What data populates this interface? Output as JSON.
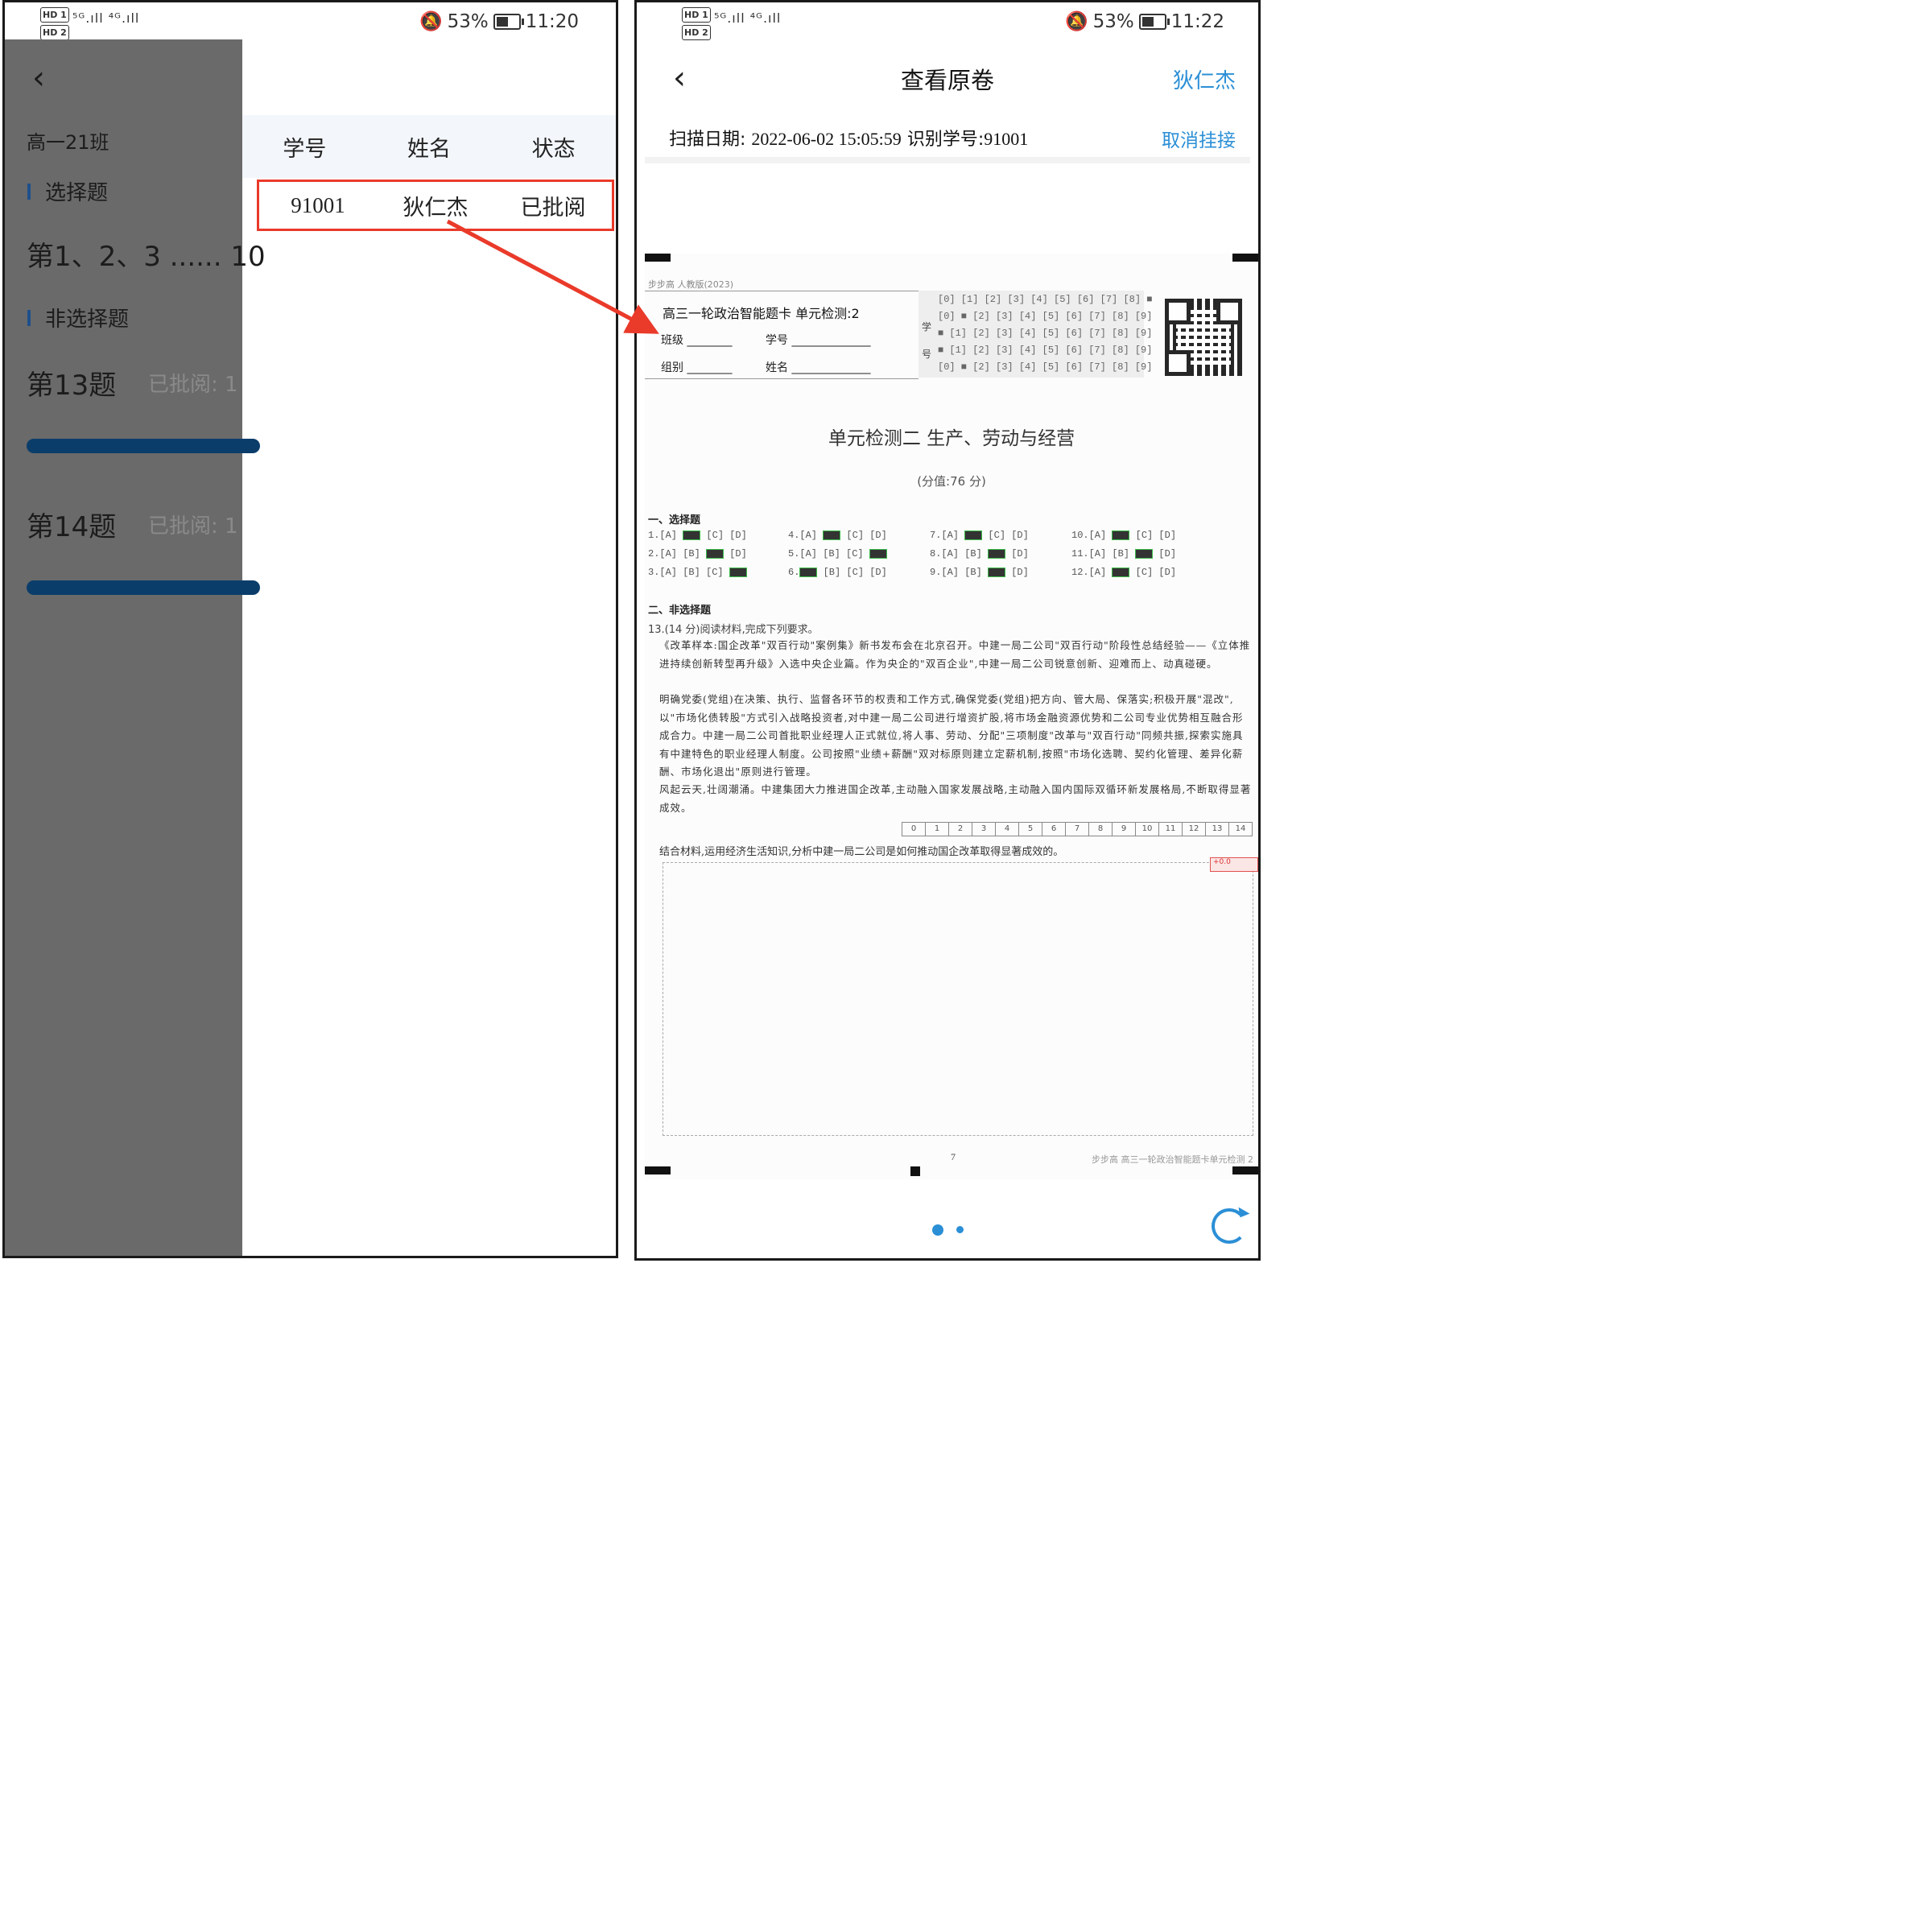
{
  "left_phone": {
    "status": {
      "hd1": "HD 1",
      "hd2": "HD 2",
      "signal": "⁵ᴳ.ıll ⁴ᴳ.ıll",
      "battery": "53%",
      "time": "11:20"
    },
    "drawer": {
      "class_name": "高一21班",
      "section_choice": "选择题",
      "choice_questions": "第1、2、3 ...... 10",
      "section_nonchoice": "非选择题",
      "q13_title": "第13题",
      "q13_status": "已批阅: 1",
      "q14_title": "第14题",
      "q14_status": "已批阅: 1"
    },
    "table": {
      "headers": [
        "学号",
        "姓名",
        "状态"
      ],
      "row": {
        "id": "91001",
        "name": "狄仁杰",
        "status": "已批阅"
      }
    }
  },
  "right_phone": {
    "status": {
      "hd1": "HD 1",
      "hd2": "HD 2",
      "signal": "⁵ᴳ.ıll ⁴ᴳ.ıll",
      "battery": "53%",
      "time": "11:22"
    },
    "nav": {
      "title": "查看原卷",
      "student": "狄仁杰"
    },
    "scan": {
      "label": "扫描日期:",
      "date": "2022-06-02 15:05:59",
      "id_label": "识别学号:",
      "id": "91001",
      "unlink": "取消挂接"
    },
    "paper": {
      "publisher": "步步高  人教版(2023)",
      "card_title": "高三一轮政治智能题卡  单元检测:2",
      "class_label": "班级",
      "group_label": "组别",
      "id_label": "学号",
      "name_label": "姓名",
      "id_side": "学号",
      "id_rows": [
        "[0] [1] [2] [3] [4] [5] [6] [7] [8] ■",
        "[0] ■ [2] [3] [4] [5] [6] [7] [8] [9]",
        "■ [1] [2] [3] [4] [5] [6] [7] [8] [9]",
        "■ [1] [2] [3] [4] [5] [6] [7] [8] [9]",
        "[0] ■ [2] [3] [4] [5] [6] [7] [8] [9]"
      ],
      "unit_title": "单元检测二  生产、劳动与经营",
      "unit_sub": "(分值:76 分)",
      "sec1": "一、选择题",
      "mc_rows": [
        [
          "1.[A]",
          "[C]  [D]",
          "4.[A]",
          "[C]  [D]",
          "7.[A]",
          "[C]  [D]",
          "10.[A]",
          "[C]  [D]"
        ],
        [
          "2.[A]  [B]",
          "[D]",
          "5.[A]  [B]  [C]",
          "",
          "8.[A]  [B]",
          "[D]",
          "11.[A]  [B]",
          "[D]"
        ],
        [
          "3.[A]  [B]  [C]",
          "",
          "6.",
          "[B]  [C]  [D]",
          "9.[A]  [B]",
          "[D]",
          "12.[A]",
          "[C]  [D]"
        ]
      ],
      "sec2": "二、非选择题",
      "q13": "13.(14 分)阅读材料,完成下列要求。",
      "para1": "《改革样本:国企改革\"双百行动\"案例集》新书发布会在北京召开。中建一局二公司\"双百行动\"阶段性总结经验——《立体推进持续创新转型再升级》入选中央企业篇。作为央企的\"双百企业\",中建一局二公司锐意创新、迎难而上、动真碰硬。",
      "para2": "明确党委(党组)在决策、执行、监督各环节的权责和工作方式,确保党委(党组)把方向、管大局、保落实;积极开展\"混改\",以\"市场化债转股\"方式引入战略投资者,对中建一局二公司进行增资扩股,将市场金融资源优势和二公司专业优势相互融合形成合力。中建一局二公司首批职业经理人正式就位,将人事、劳动、分配\"三项制度\"改革与\"双百行动\"同频共振,探索实施具有中建特色的职业经理人制度。公司按照\"业绩+薪酬\"双对标原则建立定薪机制,按照\"市场化选聘、契约化管理、差异化薪酬、市场化退出\"原则进行管理。",
      "para3": "风起云天,壮阔潮涌。中建集团大力推进国企改革,主动融入国家发展战略,主动融入国内国际双循环新发展格局,不断取得显著成效。",
      "scale": [
        "0",
        "1",
        "2",
        "3",
        "4",
        "5",
        "6",
        "7",
        "8",
        "9",
        "10",
        "11",
        "12",
        "13",
        "14"
      ],
      "prompt": "结合材料,运用经济生活知识,分析中建一局二公司是如何推动国企改革取得显著成效的。",
      "score_tag": "+0.0",
      "page_number": "7",
      "footer": "步步高  高三一轮政治智能题卡单元检测 2"
    }
  },
  "colors": {
    "accent": "#2b8fd6",
    "highlight": "#ea3a2a",
    "progress": "#0b3d6b",
    "overlay": "#6a6a6a"
  }
}
